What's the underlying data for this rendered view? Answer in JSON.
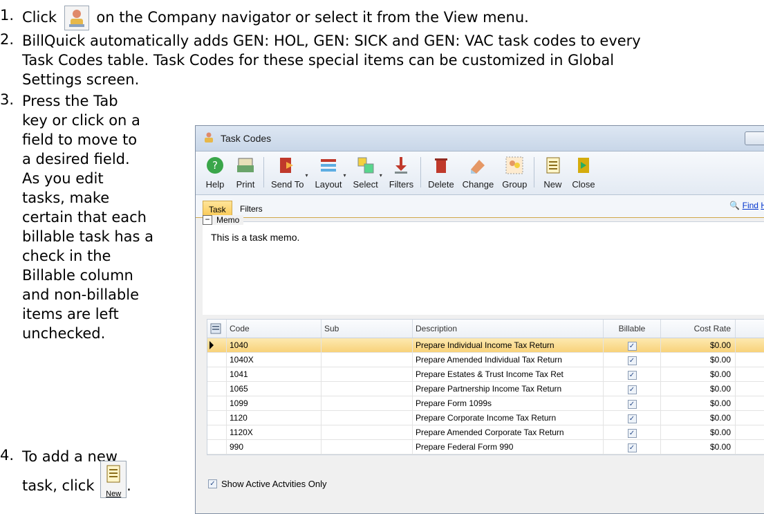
{
  "steps": [
    {
      "number": "1.",
      "before": "Click",
      "after": "on the Company navigator or select it from the View menu."
    },
    {
      "number": "2.",
      "lines": [
        "BillQuick automatically adds GEN: HOL, GEN: SICK and GEN: VAC task codes to every",
        "Task Codes table. Task Codes for these special items can be customized in Global",
        "Settings screen."
      ]
    },
    {
      "number": "3.",
      "lines": [
        "Press the Tab",
        "key or click on a",
        "field to move to",
        "a desired field.",
        "As you edit",
        "tasks, make",
        "certain that each",
        "billable task has a",
        "check in the",
        "Billable column",
        "and non-billable",
        "items are left",
        "unchecked."
      ]
    },
    {
      "number": "4.",
      "line1": "To add a new",
      "line2_before": "task, click",
      "line2_after": ".",
      "new_icon_label": "New"
    }
  ],
  "window": {
    "title": "Task Codes",
    "toolbar": [
      {
        "label": "Help",
        "icon": "help-icon"
      },
      {
        "label": "Print",
        "icon": "print-icon"
      },
      {
        "label": "Send To",
        "icon": "send-to-icon"
      },
      {
        "label": "Layout",
        "icon": "layout-icon"
      },
      {
        "label": "Select",
        "icon": "select-icon"
      },
      {
        "label": "Filters",
        "icon": "filters-icon"
      },
      {
        "label": "Delete",
        "icon": "delete-icon"
      },
      {
        "label": "Change",
        "icon": "change-icon"
      },
      {
        "label": "Group",
        "icon": "group-icon"
      },
      {
        "label": "New",
        "icon": "new-icon"
      },
      {
        "label": "Close",
        "icon": "close-icon"
      }
    ],
    "tabs": [
      "Task",
      "Filters"
    ],
    "find_label": "Find",
    "help_link_partial": "H",
    "memo_label": "Memo",
    "memo_text": "This is a task memo.",
    "columns": [
      "Code",
      "Sub",
      "Description",
      "Billable",
      "Cost Rate"
    ],
    "rows": [
      {
        "code": "1040",
        "sub": "",
        "description": "Prepare Individual Income Tax Return",
        "billable": true,
        "cost_rate": "$0.00"
      },
      {
        "code": "1040X",
        "sub": "",
        "description": "Prepare Amended Individual Tax Return",
        "billable": true,
        "cost_rate": "$0.00"
      },
      {
        "code": "1041",
        "sub": "",
        "description": "Prepare Estates & Trust Income Tax Ret",
        "billable": true,
        "cost_rate": "$0.00"
      },
      {
        "code": "1065",
        "sub": "",
        "description": "Prepare Partnership Income Tax Return",
        "billable": true,
        "cost_rate": "$0.00"
      },
      {
        "code": "1099",
        "sub": "",
        "description": "Prepare Form 1099s",
        "billable": true,
        "cost_rate": "$0.00"
      },
      {
        "code": "1120",
        "sub": "",
        "description": "Prepare Corporate Income Tax Return",
        "billable": true,
        "cost_rate": "$0.00"
      },
      {
        "code": "1120X",
        "sub": "",
        "description": "Prepare Amended Corporate Tax Return",
        "billable": true,
        "cost_rate": "$0.00"
      },
      {
        "code": "990",
        "sub": "",
        "description": "Prepare Federal Form 990",
        "billable": true,
        "cost_rate": "$0.00"
      }
    ],
    "active_only_label": "Show Active Actvities Only"
  }
}
